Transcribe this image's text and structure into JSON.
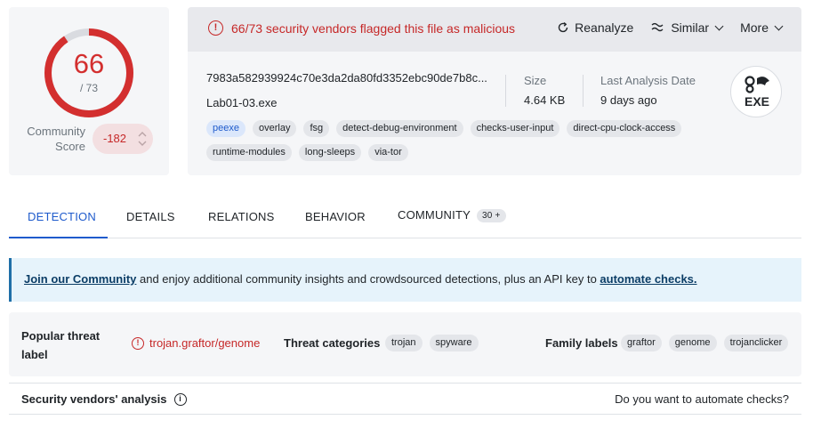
{
  "score": {
    "detections": "66",
    "total": "/ 73",
    "ratio": 0.904,
    "community_label": "Community Score",
    "community_score": "-182",
    "accent": "#d32f2f"
  },
  "banner": {
    "alert_icon": "exclamation-circle-icon",
    "alert_text": "66/73 security vendors flagged this file as malicious",
    "reanalyze": "Reanalyze",
    "similar": "Similar",
    "more": "More"
  },
  "file": {
    "hash": "7983a582939924c70e3da2da80fd3352ebc90de7b8c...",
    "name": "Lab01-03.exe",
    "size_label": "Size",
    "size_value": "4.64 KB",
    "date_label": "Last Analysis Date",
    "date_value": "9 days ago",
    "type_badge": "EXE",
    "tags": [
      "peexe",
      "overlay",
      "fsg",
      "detect-debug-environment",
      "checks-user-input",
      "direct-cpu-clock-access",
      "runtime-modules",
      "long-sleeps",
      "via-tor"
    ]
  },
  "tabs": [
    {
      "label": "DETECTION"
    },
    {
      "label": "DETAILS"
    },
    {
      "label": "RELATIONS"
    },
    {
      "label": "BEHAVIOR"
    },
    {
      "label": "COMMUNITY",
      "badge": "30 +"
    }
  ],
  "infobar": {
    "link1": "Join our Community",
    "middle": " and enjoy additional community insights and crowdsourced detections, plus an API key to ",
    "link2": "automate checks."
  },
  "threat": {
    "popular_label_title": "Popular threat label",
    "popular_label_value": "trojan.graftor/genome",
    "categories_title": "Threat categories",
    "categories": [
      "trojan",
      "spyware"
    ],
    "family_title": "Family labels",
    "families": [
      "graftor",
      "genome",
      "trojanclicker"
    ]
  },
  "vendors": {
    "title": "Security vendors' analysis",
    "cta": "Do you want to automate checks?"
  }
}
